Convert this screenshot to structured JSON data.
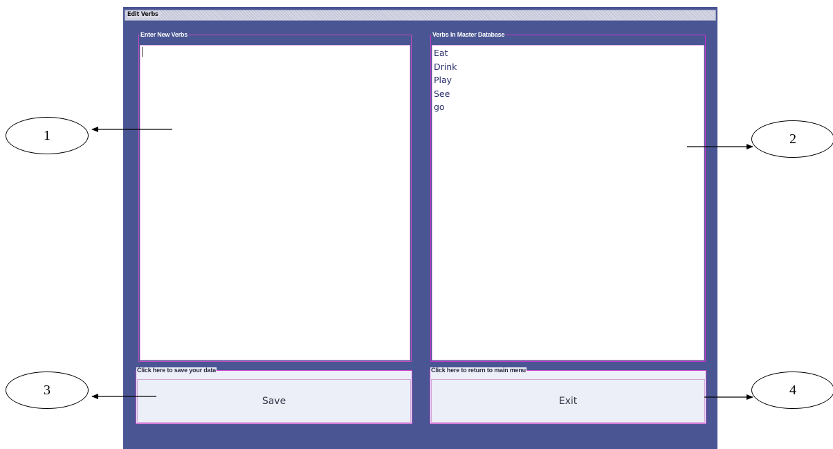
{
  "window": {
    "title": "Edit Verbs"
  },
  "left_panel": {
    "legend": "Enter New Verbs",
    "value": ""
  },
  "right_panel": {
    "legend": "Verbs In Master Database",
    "items": [
      "Eat",
      "Drink",
      "Play",
      "See",
      "go"
    ]
  },
  "save_section": {
    "legend": "Click here to save your data",
    "button_label": "Save"
  },
  "exit_section": {
    "legend": "Click here to return to main menu",
    "button_label": "Exit"
  },
  "callouts": [
    "1",
    "2",
    "3",
    "4"
  ],
  "colors": {
    "window_bg": "#4a5593",
    "panel_border": "#cc33cc",
    "title_bar": "#d7d9e6"
  }
}
